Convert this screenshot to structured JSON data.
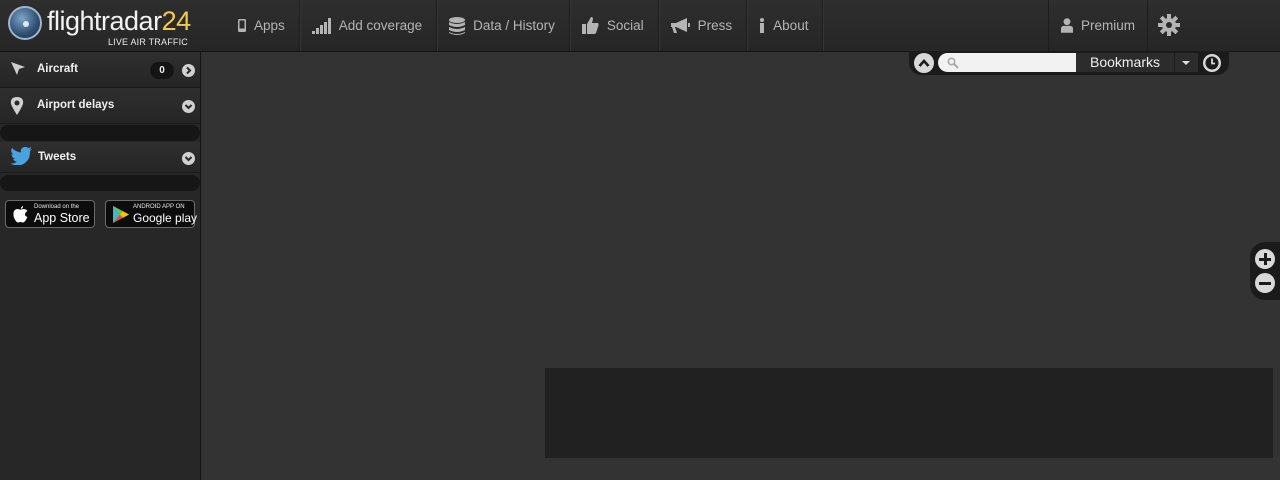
{
  "logo": {
    "text_main": "flightradar",
    "text_num": "24",
    "tagline": "LIVE AIR TRAFFIC"
  },
  "nav": {
    "items": [
      {
        "label": "Apps",
        "icon": "mobile-phone-icon"
      },
      {
        "label": "Add coverage",
        "icon": "signal-bars-icon"
      },
      {
        "label": "Data / History",
        "icon": "database-icon"
      },
      {
        "label": "Social",
        "icon": "thumbs-up-icon"
      },
      {
        "label": "Press",
        "icon": "megaphone-icon"
      },
      {
        "label": "About",
        "icon": "info-icon"
      }
    ],
    "premium": {
      "label": "Premium",
      "icon": "user-icon"
    },
    "settings_icon": "gear-icon"
  },
  "sidebar": {
    "panels": [
      {
        "label": "Aircraft",
        "icon": "plane-cursor-icon",
        "count": "0"
      },
      {
        "label": "Airport delays",
        "icon": "map-pin-icon"
      },
      {
        "label": "Tweets",
        "icon": "twitter-bird-icon"
      }
    ],
    "stores": {
      "appstore": {
        "small": "Download on the",
        "big": "App Store",
        "icon": "apple-icon"
      },
      "googleplay": {
        "small": "ANDROID APP ON",
        "big": "Google play",
        "icon": "play-triangle-icon"
      }
    }
  },
  "map": {
    "search": {
      "placeholder": "",
      "value": ""
    },
    "bookmarks_label": "Bookmarks"
  },
  "colors": {
    "background": "#333333",
    "topbar": "#2a2a2a",
    "logo_accent": "#f2c94c"
  }
}
